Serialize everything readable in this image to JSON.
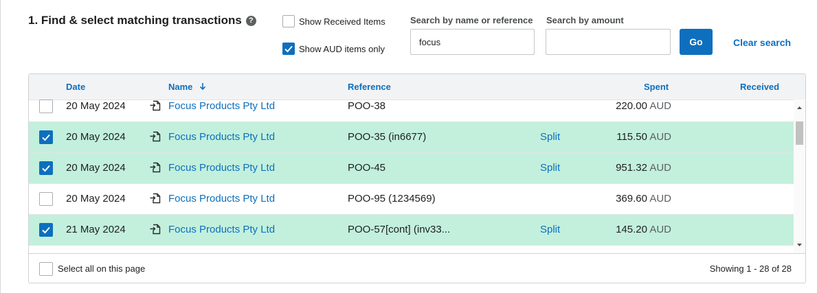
{
  "header": {
    "title": "1. Find & select matching transactions",
    "help_icon": "help-circle-icon"
  },
  "filters": {
    "show_received": {
      "label": "Show Received Items",
      "checked": false
    },
    "show_aud_only": {
      "label": "Show AUD items only",
      "checked": true
    }
  },
  "search": {
    "name_label": "Search by name or reference",
    "name_value": "focus",
    "amount_label": "Search by amount",
    "amount_value": "",
    "go_label": "Go",
    "clear_label": "Clear search"
  },
  "table": {
    "columns": {
      "date": "Date",
      "name": "Name",
      "reference": "Reference",
      "spent": "Spent",
      "received": "Received"
    },
    "sort_icon": "arrow-down-icon",
    "rows": [
      {
        "checked": false,
        "date": "20 May 2024",
        "name": "Focus Products Pty Ltd",
        "reference": "POO-38",
        "split": "",
        "amount": "220.00",
        "currency": "AUD"
      },
      {
        "checked": true,
        "date": "20 May 2024",
        "name": "Focus Products Pty Ltd",
        "reference": "POO-35 (in6677)",
        "split": "Split",
        "amount": "115.50",
        "currency": "AUD"
      },
      {
        "checked": true,
        "date": "20 May 2024",
        "name": "Focus Products Pty Ltd",
        "reference": "POO-45",
        "split": "Split",
        "amount": "951.32",
        "currency": "AUD"
      },
      {
        "checked": false,
        "date": "20 May 2024",
        "name": "Focus Products Pty Ltd",
        "reference": "POO-95 (1234569)",
        "split": "",
        "amount": "369.60",
        "currency": "AUD"
      },
      {
        "checked": true,
        "date": "21 May 2024",
        "name": "Focus Products Pty Ltd",
        "reference": "POO-57[cont] (inv33...",
        "split": "Split",
        "amount": "145.20",
        "currency": "AUD"
      }
    ]
  },
  "footer": {
    "select_all_label": "Select all on this page",
    "showing": "Showing 1 - 28 of 28"
  },
  "colors": {
    "accent": "#0d6fbe",
    "selected_row": "#c2f0dd"
  }
}
